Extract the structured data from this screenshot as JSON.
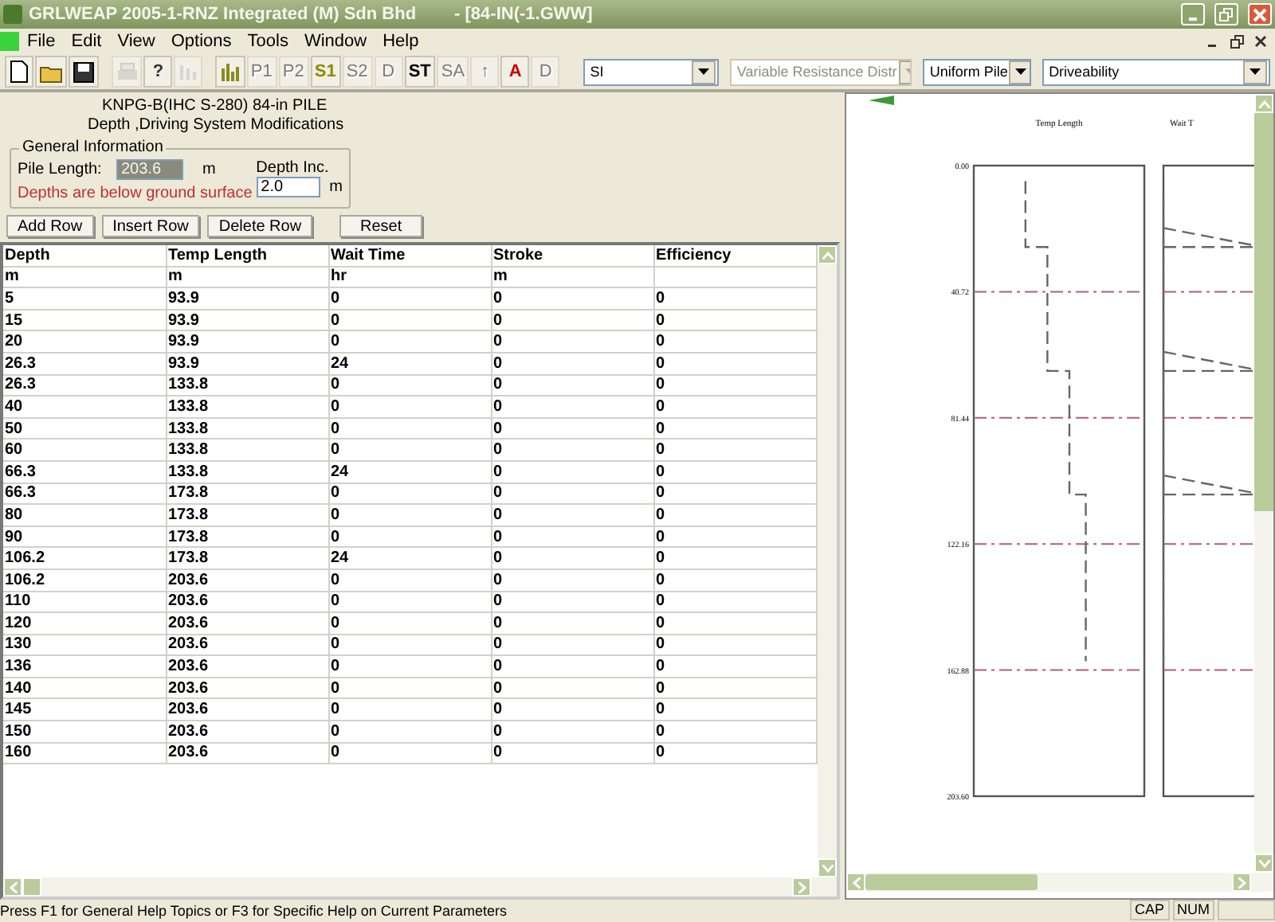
{
  "window": {
    "title": "GRLWEAP 2005-1-RNZ Integrated (M) Sdn Bhd",
    "document": "- [84-IN(-1.GWW]"
  },
  "menu": [
    "File",
    "Edit",
    "View",
    "Options",
    "Tools",
    "Window",
    "Help"
  ],
  "toolbar": [
    {
      "kind": "icon",
      "disabled": false
    },
    {
      "kind": "icon",
      "disabled": false
    },
    {
      "kind": "icon",
      "disabled": false
    },
    {
      "kind": "icon",
      "disabled": true
    },
    {
      "kind": "text",
      "label": "?",
      "disabled": false,
      "color": "#333333"
    },
    {
      "kind": "icon",
      "disabled": true
    },
    {
      "kind": "icon",
      "disabled": false
    },
    {
      "kind": "text",
      "label": "P1",
      "disabled": true,
      "color": "#7a7a7a"
    },
    {
      "kind": "text",
      "label": "P2",
      "disabled": true,
      "color": "#7a7a7a"
    },
    {
      "kind": "text",
      "label": "S1",
      "disabled": false,
      "color": "#8c8c00"
    },
    {
      "kind": "text",
      "label": "S2",
      "disabled": true,
      "color": "#7a7a7a"
    },
    {
      "kind": "text",
      "label": "D",
      "disabled": true,
      "color": "#7a7a7a"
    },
    {
      "kind": "text",
      "label": "ST",
      "disabled": false,
      "color": "#000000"
    },
    {
      "kind": "text",
      "label": "SA",
      "disabled": true,
      "color": "#7a7a7a"
    },
    {
      "kind": "text",
      "label": "↑",
      "disabled": true,
      "color": "#7a7a7a"
    },
    {
      "kind": "text",
      "label": "A",
      "disabled": false,
      "color": "#cc0000"
    },
    {
      "kind": "text",
      "label": "D",
      "disabled": true,
      "color": "#7a7a7a"
    }
  ],
  "dropdowns": [
    {
      "value": "SI",
      "disabled": false
    },
    {
      "value": "Variable Resistance Distr",
      "disabled": true
    },
    {
      "value": "Uniform Pile",
      "disabled": false
    },
    {
      "value": "Driveability",
      "disabled": false
    }
  ],
  "form": {
    "title": "KNPG-B(IHC S-280) 84-in PILE",
    "subtitle": "Depth ,Driving System Modifications",
    "group": "General Information",
    "pile_length_label": "Pile Length:",
    "pile_length": "203.6",
    "pile_length_unit": "m",
    "depth_inc_label": "Depth Inc.",
    "depth_inc": "2.0",
    "depth_inc_unit": "m",
    "note": "Depths are below ground surface"
  },
  "buttons": [
    "Add Row",
    "Insert Row",
    "Delete Row",
    "Reset"
  ],
  "table": {
    "columns": [
      "Depth",
      "Temp Length",
      "Wait Time",
      "Stroke",
      "Efficiency"
    ],
    "units": [
      "m",
      "m",
      "hr",
      "m"
    ],
    "rows": [
      [
        "5",
        "93.9",
        "0",
        "0",
        "0"
      ],
      [
        "15",
        "93.9",
        "0",
        "0",
        "0"
      ],
      [
        "20",
        "93.9",
        "0",
        "0",
        "0"
      ],
      [
        "26.3",
        "93.9",
        "24",
        "0",
        "0"
      ],
      [
        "26.3",
        "133.8",
        "0",
        "0",
        "0"
      ],
      [
        "40",
        "133.8",
        "0",
        "0",
        "0"
      ],
      [
        "50",
        "133.8",
        "0",
        "0",
        "0"
      ],
      [
        "60",
        "133.8",
        "0",
        "0",
        "0"
      ],
      [
        "66.3",
        "133.8",
        "24",
        "0",
        "0"
      ],
      [
        "66.3",
        "173.8",
        "0",
        "0",
        "0"
      ],
      [
        "80",
        "173.8",
        "0",
        "0",
        "0"
      ],
      [
        "90",
        "173.8",
        "0",
        "0",
        "0"
      ],
      [
        "106.2",
        "173.8",
        "24",
        "0",
        "0"
      ],
      [
        "106.2",
        "203.6",
        "0",
        "0",
        "0"
      ],
      [
        "110",
        "203.6",
        "0",
        "0",
        "0"
      ],
      [
        "120",
        "203.6",
        "0",
        "0",
        "0"
      ],
      [
        "130",
        "203.6",
        "0",
        "0",
        "0"
      ],
      [
        "136",
        "203.6",
        "0",
        "0",
        "0"
      ],
      [
        "140",
        "203.6",
        "0",
        "0",
        "0"
      ],
      [
        "145",
        "203.6",
        "0",
        "0",
        "0"
      ],
      [
        "150",
        "203.6",
        "0",
        "0",
        "0"
      ],
      [
        "160",
        "203.6",
        "0",
        "0",
        "0"
      ]
    ]
  },
  "plot": {
    "panels": [
      "Temp Length",
      "Wait T"
    ],
    "depth_ticks": [
      "0.00",
      "40.72",
      "81.44",
      "122.16",
      "162.88",
      "203.60"
    ]
  },
  "status_bar": {
    "text": "Press F1 for General Help Topics or F3 for Specific Help on Current Parameters",
    "indicators": [
      "CAP",
      "NUM"
    ]
  }
}
